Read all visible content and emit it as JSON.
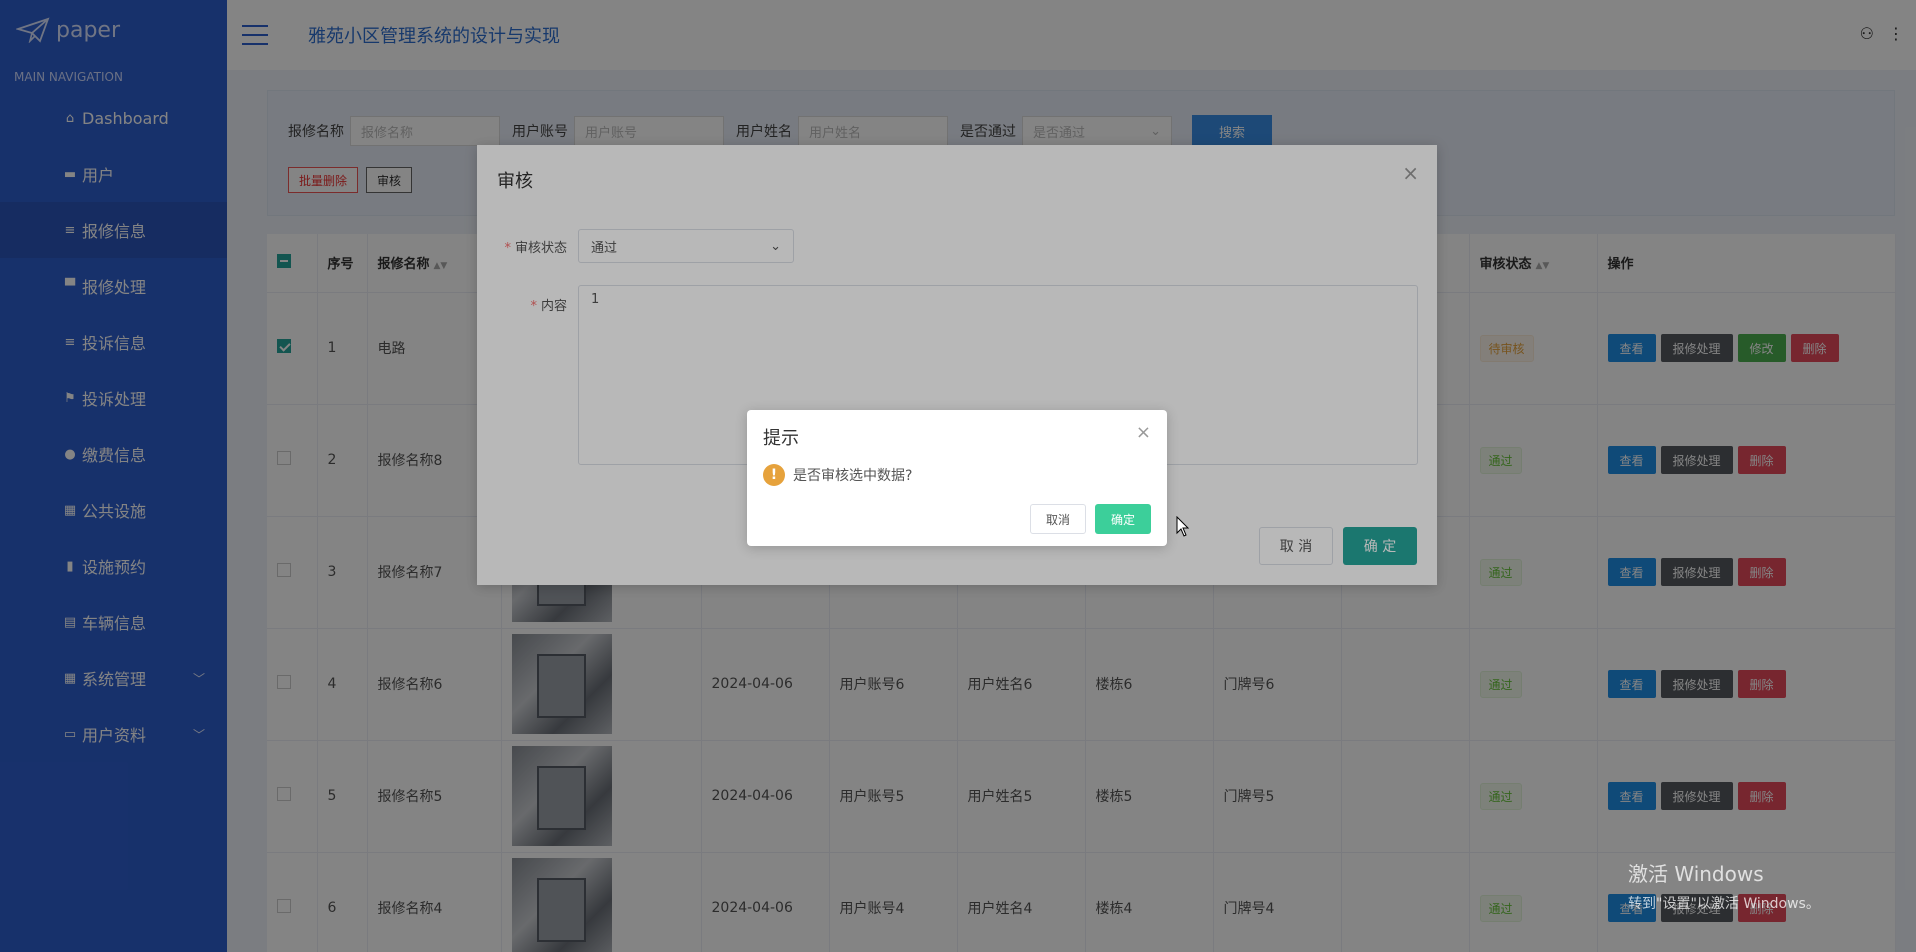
{
  "app": {
    "logo_text": "paper",
    "title": "雅苑小区管理系统的设计与实现"
  },
  "sidebar": {
    "header": "MAIN NAVIGATION",
    "items": [
      {
        "label": "Dashboard",
        "icon": "home-icon"
      },
      {
        "label": "用户",
        "icon": "id-card-icon"
      },
      {
        "label": "报修信息",
        "icon": "list-icon",
        "active": true
      },
      {
        "label": "报修处理",
        "icon": "monitor-icon"
      },
      {
        "label": "投诉信息",
        "icon": "list-icon"
      },
      {
        "label": "投诉处理",
        "icon": "flag-icon"
      },
      {
        "label": "缴费信息",
        "icon": "user-icon"
      },
      {
        "label": "公共设施",
        "icon": "grid-icon"
      },
      {
        "label": "设施预约",
        "icon": "bar-icon"
      },
      {
        "label": "车辆信息",
        "icon": "clipboard-icon"
      },
      {
        "label": "系统管理",
        "icon": "grid-icon",
        "expandable": true
      },
      {
        "label": "用户资料",
        "icon": "card-icon",
        "expandable": true
      }
    ]
  },
  "search": {
    "name_label": "报修名称",
    "name_placeholder": "报修名称",
    "account_label": "用户账号",
    "account_placeholder": "用户账号",
    "username_label": "用户姓名",
    "username_placeholder": "用户姓名",
    "pass_label": "是否通过",
    "pass_placeholder": "是否通过",
    "search_button": "搜索"
  },
  "actions": {
    "batch_delete": "批量删除",
    "review": "审核"
  },
  "table": {
    "headers": {
      "index": "序号",
      "name": "报修名称",
      "status": "审核状态",
      "ops": "操作"
    },
    "rows": [
      {
        "index": "1",
        "name": "电路",
        "date": "",
        "account": "",
        "username": "",
        "building": "",
        "door": "",
        "status": "待审核",
        "checked": true,
        "editable": true
      },
      {
        "index": "2",
        "name": "报修名称8",
        "date": "",
        "account": "",
        "username": "",
        "building": "",
        "door": "",
        "status": "通过",
        "checked": false
      },
      {
        "index": "3",
        "name": "报修名称7",
        "date": "",
        "account": "",
        "username": "",
        "building": "",
        "door": "",
        "status": "通过",
        "checked": false
      },
      {
        "index": "4",
        "name": "报修名称6",
        "date": "2024-04-06",
        "account": "用户账号6",
        "username": "用户姓名6",
        "building": "楼栋6",
        "door": "门牌号6",
        "status": "通过",
        "checked": false
      },
      {
        "index": "5",
        "name": "报修名称5",
        "date": "2024-04-06",
        "account": "用户账号5",
        "username": "用户姓名5",
        "building": "楼栋5",
        "door": "门牌号5",
        "status": "通过",
        "checked": false
      },
      {
        "index": "6",
        "name": "报修名称4",
        "date": "2024-04-06",
        "account": "用户账号4",
        "username": "用户姓名4",
        "building": "楼栋4",
        "door": "门牌号4",
        "status": "通过",
        "checked": false
      }
    ],
    "op_labels": {
      "view": "查看",
      "process": "报修处理",
      "edit": "修改",
      "delete": "删除"
    }
  },
  "review_dialog": {
    "title": "审核",
    "status_label": "审核状态",
    "status_value": "通过",
    "content_label": "内容",
    "content_value": "1",
    "cancel": "取 消",
    "confirm": "确 定"
  },
  "confirm_dialog": {
    "title": "提示",
    "message": "是否审核选中数据?",
    "cancel": "取消",
    "confirm": "确定"
  },
  "watermark": {
    "line1": "激活 Windows",
    "line2": "转到\"设置\"以激活 Windows。"
  }
}
